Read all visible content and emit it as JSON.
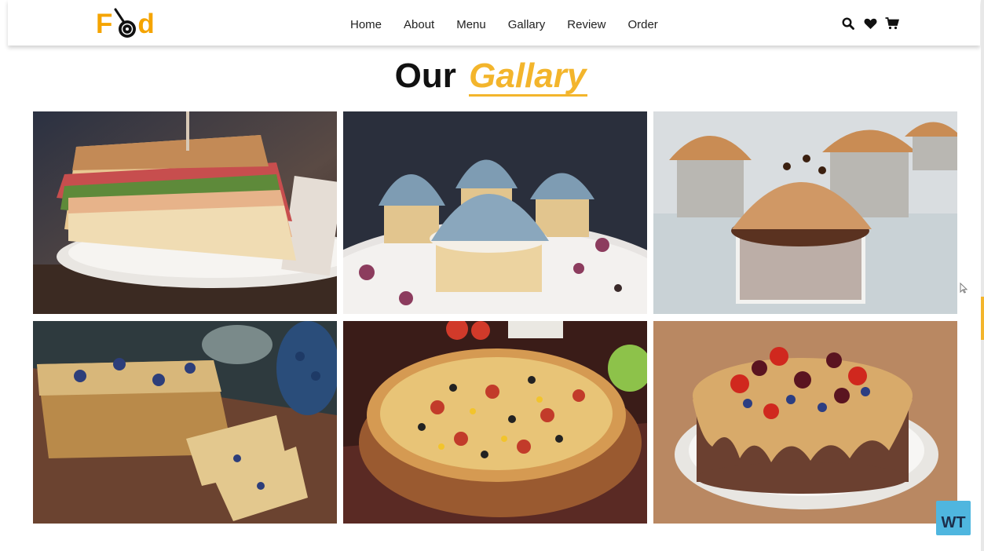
{
  "header": {
    "logo": {
      "text_prefix": "F",
      "text_suffix": "d"
    },
    "nav": [
      {
        "label": "Home"
      },
      {
        "label": "About"
      },
      {
        "label": "Menu"
      },
      {
        "label": "Gallary"
      },
      {
        "label": "Review"
      },
      {
        "label": "Order"
      }
    ],
    "icons": [
      "search-icon",
      "heart-icon",
      "cart-icon"
    ]
  },
  "section": {
    "title_plain": "Our",
    "title_accent": "Gallary"
  },
  "gallery": {
    "images": [
      "sandwich",
      "blue-frosted-cupcakes",
      "chocolate-cupcakes",
      "blueberry-bread",
      "pizza",
      "fruit-topped-cake"
    ]
  },
  "badge": {
    "text": "WT"
  },
  "colors": {
    "accent": "#f3b52c",
    "logo": "#f5a400",
    "text": "#111111"
  }
}
